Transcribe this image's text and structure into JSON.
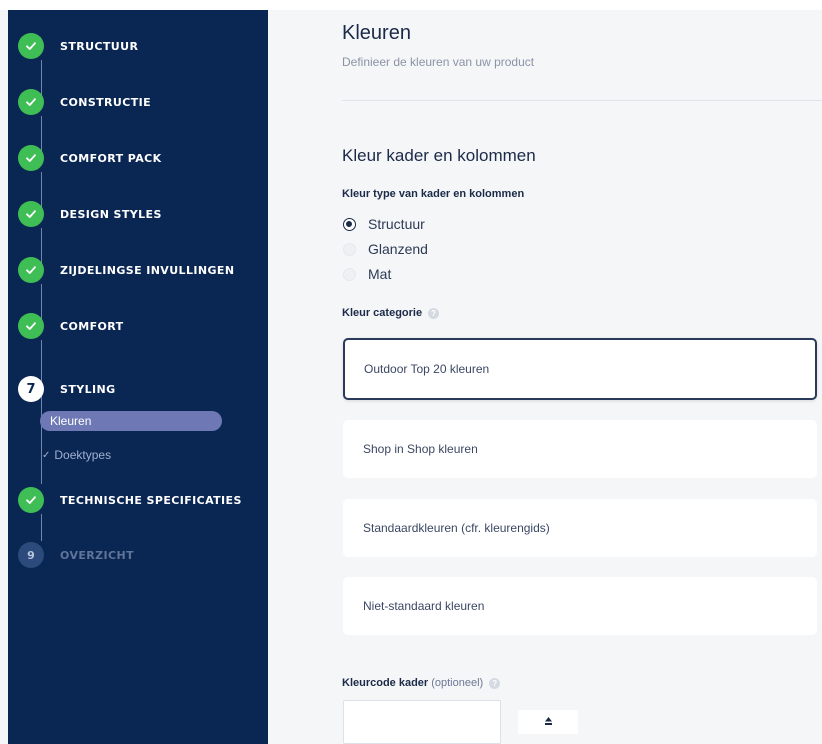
{
  "sidebar": {
    "steps": [
      {
        "label": "STRUCTUUR",
        "status": "done"
      },
      {
        "label": "CONSTRUCTIE",
        "status": "done"
      },
      {
        "label": "COMFORT PACK",
        "status": "done"
      },
      {
        "label": "DESIGN STYLES",
        "status": "done"
      },
      {
        "label": "ZIJDELINGSE INVULLINGEN",
        "status": "done"
      },
      {
        "label": "COMFORT",
        "status": "done"
      },
      {
        "label": "STYLING",
        "status": "current",
        "number": "7"
      },
      {
        "label": "TECHNISCHE SPECIFICATIES",
        "status": "done"
      },
      {
        "label": "OVERZICHT",
        "status": "pending",
        "number": "9"
      }
    ],
    "substeps": {
      "active": "Kleuren",
      "done": "Doektypes"
    },
    "check_glyph": "✓"
  },
  "main": {
    "title": "Kleuren",
    "subtitle": "Definieer de kleuren van uw product",
    "section_title": "Kleur kader en kolommen",
    "type_label": "Kleur type van kader en kolommen",
    "type_options": [
      {
        "label": "Structuur",
        "checked": true
      },
      {
        "label": "Glanzend",
        "checked": false
      },
      {
        "label": "Mat",
        "checked": false
      }
    ],
    "category_label": "Kleur categorie",
    "categories": [
      {
        "label": "Outdoor Top 20 kleuren",
        "selected": true
      },
      {
        "label": "Shop in Shop kleuren",
        "selected": false
      },
      {
        "label": "Standaardkleuren (cfr. kleurengids)",
        "selected": false
      },
      {
        "label": "Niet-standaard kleuren",
        "selected": false
      }
    ],
    "colorcode_label": "Kleurcode kader",
    "colorcode_optional": "(optioneel)",
    "colorcode_value": "",
    "info_glyph": "?"
  },
  "colors": {
    "sidebar_bg": "#0a2653",
    "done_green": "#3fbe55",
    "active_pill": "#6e78b4",
    "text_dark": "#1b2a48"
  }
}
